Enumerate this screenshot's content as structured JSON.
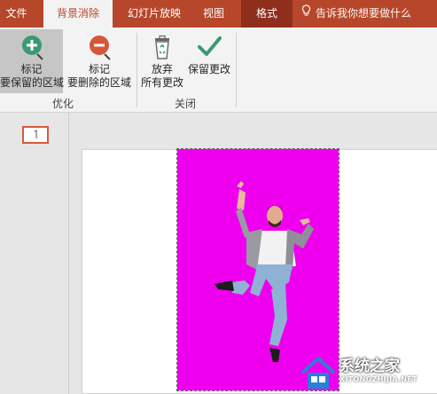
{
  "tabs": [
    {
      "label": "文件"
    },
    {
      "label": "背景消除"
    },
    {
      "label": "幻灯片放映"
    },
    {
      "label": "视图"
    },
    {
      "label": "格式"
    }
  ],
  "tell_me": "告诉我你想要做什么",
  "ribbon": {
    "mark_keep": {
      "line1": "标记",
      "line2": "要保留的区域",
      "icon": "plus-circle-icon"
    },
    "mark_remove": {
      "line1": "标记",
      "line2": "要删除的区域",
      "icon": "minus-circle-icon"
    },
    "discard": {
      "line1": "放弃",
      "line2": "所有更改",
      "icon": "recycle-bin-icon"
    },
    "keep": {
      "line1": "保留更改",
      "icon": "checkmark-icon"
    },
    "group_refine": "优化",
    "group_close": "关闭"
  },
  "watermark": {
    "title": "系统之家",
    "url": "XITONGZHIJIA.NET"
  },
  "colors": {
    "accent": "#b7472a",
    "removal_overlay": "#ee00ee"
  }
}
